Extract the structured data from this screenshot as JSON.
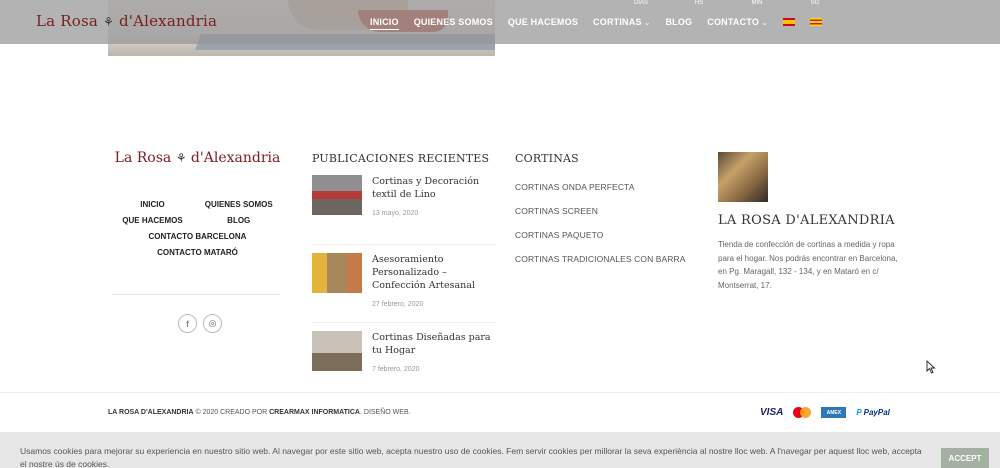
{
  "header": {
    "logo_text": "La Rosa",
    "logo_text2": "d'Alexandria",
    "nav": [
      {
        "label": "INICIO",
        "active": true
      },
      {
        "label": "QUIENES SOMOS"
      },
      {
        "label": "QUE HACEMOS"
      },
      {
        "label": "CORTINAS"
      },
      {
        "label": "BLOG"
      },
      {
        "label": "CONTACTO"
      }
    ],
    "countdown": [
      "DIAS",
      "HS",
      "MIN",
      "SG"
    ]
  },
  "footer": {
    "logo_text": "La Rosa",
    "logo_text2": "d'Alexandria",
    "links": [
      "INICIO",
      "QUIENES SOMOS",
      "QUE HACEMOS",
      "BLOG",
      "CONTACTO BARCELONA",
      "CONTACTO MATARÓ"
    ],
    "posts_title": "PUBLICACIONES RECIENTES",
    "posts": [
      {
        "title": "Cortinas y Decoración textil de Lino",
        "date": "13 mayo, 2020"
      },
      {
        "title": "Asesoramiento Personalizado – Confección Artesanal",
        "date": "27 febrero, 2020"
      },
      {
        "title": "Cortinas Diseñadas para tu Hogar",
        "date": "7 febrero, 2020"
      }
    ],
    "cortinas_title": "CORTINAS",
    "cortinas": [
      "CORTINAS ONDA PERFECTA",
      "CORTINAS SCREEN",
      "CORTINAS PAQUETO",
      "CORTINAS TRADICIONALES CON BARRA"
    ],
    "about_title": "LA ROSA D'ALEXANDRIA",
    "about_text": "Tienda de confección de cortinas a medida y ropa para el hogar. Nos podrás encontrar en Barcelona, en Pg. Maragall, 132 - 134, y en Mataró en c/ Montserrat, 17."
  },
  "bottom": {
    "brand": "LA ROSA D'ALEXANDRIA",
    "copyright_mid": " © 2020 CREADO POR ",
    "creator": "CREARMAX INFORMATICA",
    "suffix": ". DISEÑO WEB.",
    "payments": [
      "VISA",
      "mastercard-icon",
      "AMEX",
      "PayPal"
    ]
  },
  "cookie": {
    "text": "Usamos cookies para mejorar su experiencia en nuestro sitio web. Al navegar por este sitio web, acepta nuestro uso de cookies. Fem servir cookies per millorar la seva experiència al nostre lloc web. A l'navegar per aquest lloc web, accepta el nostre ús de cookies.",
    "accept": "ACCEPT"
  }
}
